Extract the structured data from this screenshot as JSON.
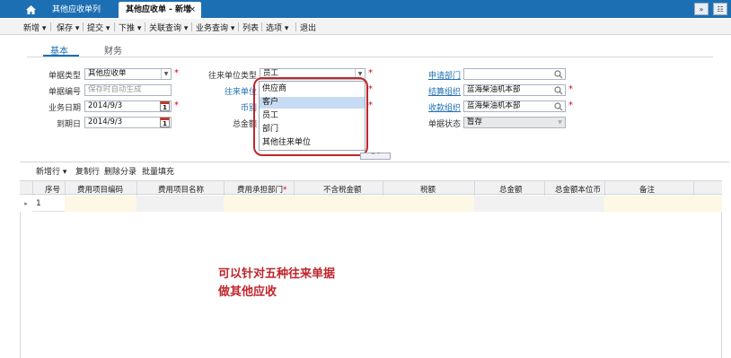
{
  "tabs": {
    "home_icon": "home-icon",
    "tab1": "其他应收单列表",
    "tab2": "其他应收单 - 新增",
    "tab2_close": "×",
    "right_btn1": "»",
    "right_btn2": "☷"
  },
  "toolbar": {
    "new": "新增 ▾",
    "save": "保存 ▾",
    "submit": "提交 ▾",
    "push": "下推 ▾",
    "related": "关联查询 ▾",
    "business": "业务查询 ▾",
    "list": "列表",
    "options": "选项 ▾",
    "exit": "退出"
  },
  "subtabs": {
    "basic": "基本",
    "finance": "财务"
  },
  "form": {
    "doc_type_label": "单据类型",
    "doc_type_value": "其他应收单",
    "doc_no_label": "单据编号",
    "doc_no_placeholder": "保存时自动生成",
    "biz_date_label": "业务日期",
    "biz_date_value": "2014/9/3",
    "due_date_label": "到期日",
    "due_date_value": "2014/9/3",
    "contact_type_label": "往来单位类型",
    "contact_type_value": "员工",
    "contact_label": "往来单位",
    "currency_label": "币别",
    "total_label": "总金额",
    "apply_dept_label": "申请部门",
    "settle_org_label": "结算组织",
    "settle_org_value": "蓝海柴油机本部",
    "receive_org_label": "收款组织",
    "receive_org_value": "蓝海柴油机本部",
    "status_label": "单据状态",
    "status_value": "暂存",
    "calendar_day": "1"
  },
  "dropdown": {
    "options": [
      "供应商",
      "客户",
      "员工",
      "部门",
      "其他往来单位"
    ],
    "highlighted": "客户"
  },
  "collapse_toggle": "^ ˅",
  "grid_toolbar": {
    "add_row": "新增行 ▾",
    "copy_row": "复制行",
    "delete_entry": "删除分录",
    "batch_fill": "批量填充"
  },
  "grid": {
    "headers": [
      "序号",
      "费用项目编码",
      "费用项目名称",
      "费用承担部门",
      "不含税金额",
      "税额",
      "总金额",
      "总金额本位币",
      "备注"
    ],
    "rows": [
      {
        "seq": "1"
      }
    ]
  },
  "annotation": {
    "line1": "可以针对五种往来单据",
    "line2": "做其他应收"
  },
  "colors": {
    "accent": "#1d6fb3",
    "required": "#d0021b",
    "highlight_ring": "#c0252b"
  }
}
